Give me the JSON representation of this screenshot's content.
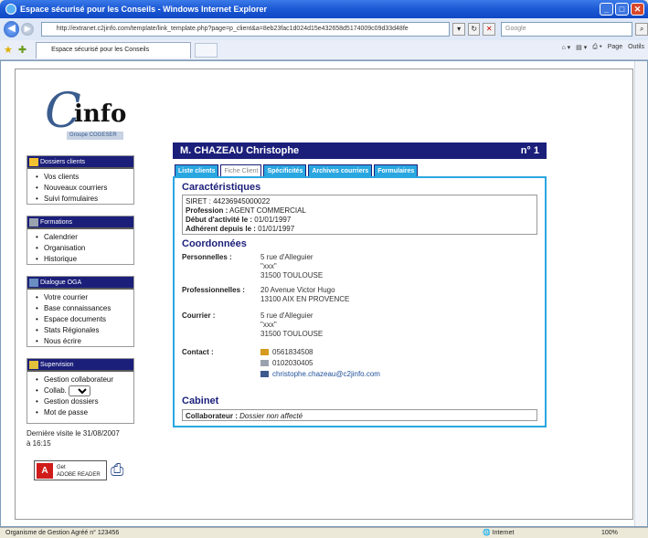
{
  "window": {
    "title": "Espace sécurisé pour les Conseils - Windows Internet Explorer",
    "url": "http://extranet.c2jinfo.com/template/link_template.php?page=p_client&a=8eb23fac1d024d15e432658d5174009c09d33d48fe",
    "search_placeholder": "Google",
    "tab_label": "Espace sécurisé pour les Conseils",
    "cmd_page": "Page",
    "cmd_tools": "Outils"
  },
  "logo": {
    "letter": "C",
    "word": "info",
    "group": "Groupe COGESER"
  },
  "sidebar": {
    "sections": [
      {
        "title": "Dossiers clients",
        "items": [
          "Vos clients",
          "Nouveaux courriers",
          "Suivi formulaires"
        ]
      },
      {
        "title": "Formations",
        "items": [
          "Calendrier",
          "Organisation",
          "Historique"
        ]
      },
      {
        "title": "Dialogue OGA",
        "items": [
          "Votre courrier",
          "Base connaissances",
          "Espace documents",
          "Stats Régionales",
          "Nous écrire"
        ]
      },
      {
        "title": "Supervision",
        "items": [
          "Gestion collaborateur",
          "Collab.",
          "Gestion dossiers",
          "Mot de passe"
        ]
      }
    ],
    "last_visit_line1": "Dernière visite le 31/08/2007",
    "last_visit_line2": "à 16:15",
    "adobe_line1": "Get",
    "adobe_line2": "ADOBE READER"
  },
  "client": {
    "name": "M. CHAZEAU Christophe",
    "number": "n° 1"
  },
  "tabs": [
    "Liste clients",
    "Fiche Client",
    "Spécificités",
    "Archives courriers",
    "Formulaires"
  ],
  "active_tab": "Fiche Client",
  "caracteristiques": {
    "title": "Caractéristiques",
    "siret_label": "SIRET :",
    "siret": "44236945000022",
    "profession_label": "Profession :",
    "profession": "AGENT COMMERCIAL",
    "debut_label": "Début d'activité le :",
    "debut": "01/01/1997",
    "adherent_label": "Adhérent depuis le :",
    "adherent": "01/01/1997"
  },
  "coordonnees": {
    "title": "Coordonnées",
    "personnelles_label": "Personnelles :",
    "personnelles": [
      "5 rue d'Alleguier",
      "\"xxx\"",
      "31500 TOULOUSE"
    ],
    "professionnelles_label": "Professionnelles :",
    "professionnelles": [
      "20 Avenue Victor Hugo",
      "13100 AIX EN PROVENCE"
    ],
    "courrier_label": "Courrier :",
    "courrier": [
      "5 rue d'Alleguier",
      "\"xxx\"",
      "31500 TOULOUSE"
    ],
    "contact_label": "Contact :",
    "phone": "0561834508",
    "fax": "0102030405",
    "email": "christophe.chazeau@c2jinfo.com"
  },
  "cabinet": {
    "title": "Cabinet",
    "collab_label": "Collaborateur :",
    "collab_value": "Dossier non affecté"
  },
  "status": {
    "left": "Organisme de Gestion Agréé n° 123456",
    "zone": "Internet",
    "zoom": "100%"
  }
}
